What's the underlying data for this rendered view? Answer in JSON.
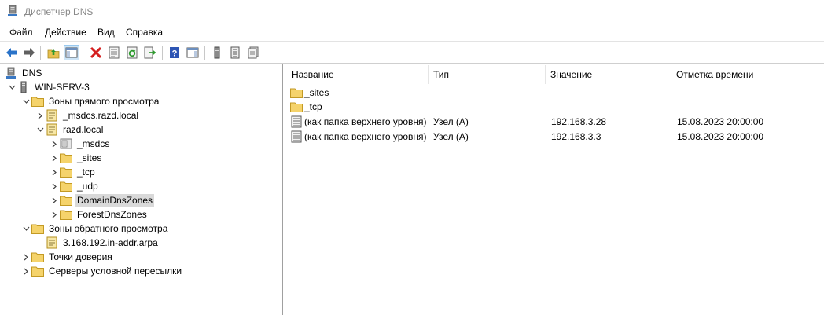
{
  "window": {
    "title": "Диспетчер DNS",
    "icon": "dns-manager-icon"
  },
  "menu": [
    "Файл",
    "Действие",
    "Вид",
    "Справка"
  ],
  "toolbar": [
    "back-arrow-icon",
    "forward-arrow-icon",
    "up-folder-icon",
    "show-hide-tree-icon",
    "delete-icon",
    "properties-icon",
    "refresh-icon",
    "export-list-icon",
    "help-icon",
    "action-pane-icon",
    "server-icon",
    "list-icon",
    "zone-icon"
  ],
  "tree": {
    "root": "DNS",
    "server": "WIN-SERV-3",
    "forward_zones": "Зоны прямого просмотра",
    "msdcs_zone": "_msdcs.razd.local",
    "razd_zone": "razd.local",
    "msdcs": "_msdcs",
    "sites": "_sites",
    "tcp": "_tcp",
    "udp": "_udp",
    "domaindns": "DomainDnsZones",
    "forestdns": "ForestDnsZones",
    "reverse_zones": "Зоны обратного просмотра",
    "reverse_zone": "3.168.192.in-addr.arpa",
    "trust_points": "Точки доверия",
    "conditional": "Серверы условной пересылки"
  },
  "columns": {
    "name": "Название",
    "type": "Тип",
    "value": "Значение",
    "timestamp": "Отметка времени"
  },
  "rows": [
    {
      "name": "_sites",
      "type": "",
      "value": "",
      "timestamp": "",
      "icon": "folder-icon"
    },
    {
      "name": "_tcp",
      "type": "",
      "value": "",
      "timestamp": "",
      "icon": "folder-icon"
    },
    {
      "name": "(как папка верхнего уровня)",
      "type": "Узел (A)",
      "value": "192.168.3.28",
      "timestamp": "15.08.2023 20:00:00",
      "icon": "record-icon"
    },
    {
      "name": "(как папка верхнего уровня)",
      "type": "Узел (A)",
      "value": "192.168.3.3",
      "timestamp": "15.08.2023 20:00:00",
      "icon": "record-icon"
    }
  ],
  "colors": {
    "folder": "#f5d36b",
    "selection": "#d9d9d9",
    "toolbar_active": "#cce4f7"
  }
}
